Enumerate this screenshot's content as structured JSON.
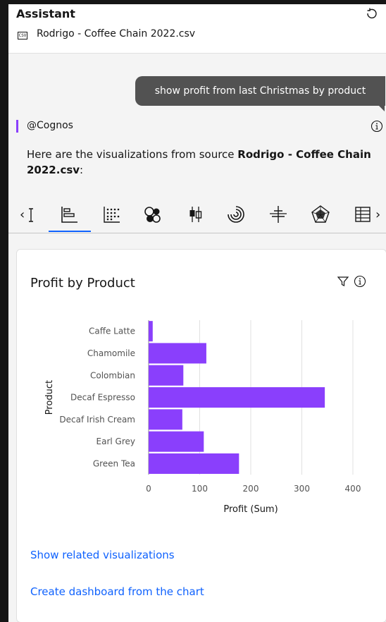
{
  "header": {
    "title": "Assistant",
    "file_badge": "CSV",
    "file_name": "Rodrigo - Coffee Chain 2022.csv"
  },
  "user_message": "show profit from last Christmas by product",
  "reply": {
    "speaker": "@Cognos",
    "intro_prefix": "Here are the visualizations from source ",
    "intro_source": "Rodrigo - Coffee Chain 2022.csv",
    "intro_suffix": ":"
  },
  "viz_tabs": [
    {
      "icon": "bar-chart-icon",
      "selected": true
    },
    {
      "icon": "dot-matrix-icon",
      "selected": false
    },
    {
      "icon": "bubble-chart-icon",
      "selected": false
    },
    {
      "icon": "candlestick-icon",
      "selected": false
    },
    {
      "icon": "radial-chart-icon",
      "selected": false
    },
    {
      "icon": "bullet-chart-icon",
      "selected": false
    },
    {
      "icon": "radar-chart-icon",
      "selected": false
    },
    {
      "icon": "table-icon",
      "selected": false
    }
  ],
  "card": {
    "title": "Profit by Product",
    "links": {
      "related": "Show related visualizations",
      "dashboard": "Create dashboard from the chart"
    }
  },
  "colors": {
    "bar": "#8a3ffc",
    "link": "#0f62fe",
    "tab_selected": "#0f62fe",
    "bubble": "#525252"
  },
  "chart_data": {
    "type": "bar",
    "orientation": "horizontal",
    "title": "Profit by Product",
    "xlabel": "Profit (Sum)",
    "ylabel": "Product",
    "categories": [
      "Caffe Latte",
      "Chamomile",
      "Colombian",
      "Decaf Espresso",
      "Decaf Irish Cream",
      "Earl Grey",
      "Green Tea"
    ],
    "values": [
      8,
      113,
      68,
      345,
      66,
      108,
      177
    ],
    "xlim": [
      0,
      400
    ],
    "xticks": [
      0,
      100,
      200,
      300,
      400
    ],
    "grid": true
  }
}
